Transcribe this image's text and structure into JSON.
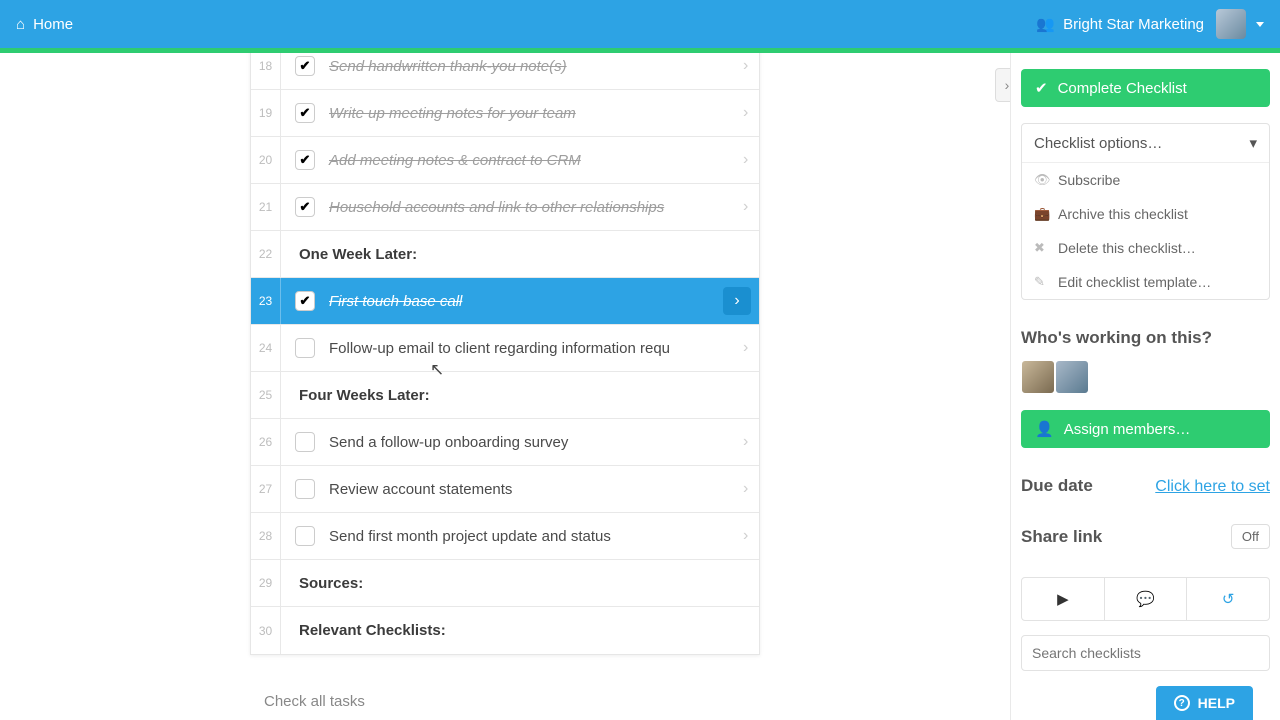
{
  "topbar": {
    "home": "Home",
    "org": "Bright Star Marketing"
  },
  "rows": [
    {
      "n": "18",
      "text": "Send handwritten thank-you note(s)",
      "type": "task",
      "checked": true,
      "chevron": true
    },
    {
      "n": "19",
      "text": "Write up meeting notes for your team",
      "type": "task",
      "checked": true,
      "chevron": true
    },
    {
      "n": "20",
      "text": "Add meeting notes & contract to CRM",
      "type": "task",
      "checked": true,
      "chevron": true
    },
    {
      "n": "21",
      "text": "Household accounts and link to other relationships",
      "type": "task",
      "checked": true,
      "chevron": true
    },
    {
      "n": "22",
      "text": "One Week Later:",
      "type": "heading"
    },
    {
      "n": "23",
      "text": "First touch base call",
      "type": "task",
      "checked": true,
      "chevron": true,
      "selected": true
    },
    {
      "n": "24",
      "text": "Follow-up email to client regarding information requ",
      "type": "task",
      "checked": false,
      "chevron": true
    },
    {
      "n": "25",
      "text": "Four Weeks Later:",
      "type": "heading"
    },
    {
      "n": "26",
      "text": "Send a follow-up onboarding survey",
      "type": "task",
      "checked": false,
      "chevron": true
    },
    {
      "n": "27",
      "text": "Review account statements",
      "type": "task",
      "checked": false,
      "chevron": true
    },
    {
      "n": "28",
      "text": "Send first month project update and status",
      "type": "task",
      "checked": false,
      "chevron": true
    },
    {
      "n": "29",
      "text": "Sources:",
      "type": "heading"
    },
    {
      "n": "30",
      "text": "Relevant Checklists:",
      "type": "heading"
    }
  ],
  "check_all": "Check all tasks",
  "side": {
    "complete_btn": "Complete Checklist",
    "options_label": "Checklist options…",
    "opts": {
      "subscribe": "Subscribe",
      "archive": "Archive this checklist",
      "delete": "Delete this checklist…",
      "edit_tpl": "Edit checklist template…"
    },
    "who_label": "Who's working on this?",
    "assign_btn": "Assign members…",
    "due_label": "Due date",
    "due_link": "Click here to set",
    "share_label": "Share link",
    "off": "Off",
    "search_placeholder": "Search checklists"
  },
  "help": "HELP"
}
